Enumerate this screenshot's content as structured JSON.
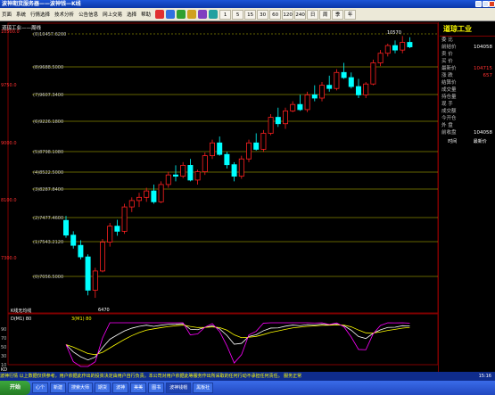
{
  "window": {
    "title": "波神期货服务器——波神钱—K线"
  },
  "menu": {
    "items": [
      "页面",
      "系统",
      "行情选择",
      "技术分析",
      "公告信息",
      "网上交易",
      "选择",
      "帮助"
    ],
    "periods": [
      "1",
      "5",
      "15",
      "30",
      "60",
      "120",
      "240",
      "日",
      "周",
      "季",
      "年"
    ]
  },
  "chart": {
    "header": "道琼工业——周线",
    "stat_label": "K线无均线",
    "indicator_labels": [
      "D(M1) 80",
      "3(M1) 80"
    ],
    "y_ticks": [
      "10500.0",
      "9750.0",
      "9000.0",
      "8100.0",
      "7300.0"
    ],
    "levels": [
      "(0)10457.6200",
      "(8)9688.5000",
      "(7)9607.3400",
      "(6)9226.1800",
      "(5)8798.1080",
      "(4)8522.5000",
      "(3)8287.8400",
      "(2)7477.4600",
      "(1)7543.2120",
      "(0)7056.5000"
    ],
    "high_marker": "10570",
    "low_marker": "6470",
    "sub_y_ticks": [
      "90",
      "70",
      "50",
      "30",
      "10"
    ],
    "sub_label": "KD"
  },
  "sidebar": {
    "title": "道琼工业",
    "rows": [
      {
        "k": "委 比",
        "v": ""
      },
      {
        "k": "前结价",
        "v": "104058"
      },
      {
        "k": "卖 价",
        "v": ""
      },
      {
        "k": "买 价",
        "v": ""
      },
      {
        "k": "最新价",
        "v": "104715"
      },
      {
        "k": "涨 跌",
        "v": "657"
      },
      {
        "k": "结算价",
        "v": ""
      },
      {
        "k": "成交量",
        "v": ""
      },
      {
        "k": "持仓量",
        "v": ""
      },
      {
        "k": "现 手",
        "v": ""
      },
      {
        "k": "成交额",
        "v": ""
      },
      {
        "k": "今开仓",
        "v": ""
      },
      {
        "k": "外 盘",
        "v": ""
      },
      {
        "k": "前收盘",
        "v": "104058"
      }
    ],
    "tabs": [
      "时间",
      "最新价"
    ]
  },
  "status": {
    "text": "波神行情 以上数据仅供参考，用户依据此作出的投资决定由用户自行负责。本公司对用户依据此等服务作出所采取的任何行动不承担任何责任。 服务正常",
    "time": "15:16"
  },
  "taskbar": {
    "start": "开始",
    "tasks": [
      "心个",
      "新建",
      "搜索大师",
      "期货",
      "波神",
      "美美",
      "图书",
      "波神钱帽",
      "黑板社"
    ]
  },
  "colors": {
    "up": "#ff2020",
    "down": "#00ffff",
    "level": "#c8c800",
    "k_line": "#ffffff",
    "d_line": "#ffff00",
    "j_line": "#ff00ff"
  },
  "chart_data": {
    "type": "candlestick",
    "title": "道琼工业——周线",
    "y_range": [
      6300,
      10700
    ],
    "ohlc": [
      [
        7690,
        7760,
        7420,
        7460
      ],
      [
        7460,
        7520,
        7250,
        7300
      ],
      [
        7300,
        7380,
        7080,
        7120
      ],
      [
        7120,
        7160,
        6520,
        6600
      ],
      [
        6600,
        6950,
        6480,
        6900
      ],
      [
        6900,
        7400,
        6880,
        7350
      ],
      [
        7350,
        7650,
        7280,
        7600
      ],
      [
        7600,
        7700,
        7450,
        7520
      ],
      [
        7520,
        7950,
        7480,
        7900
      ],
      [
        7900,
        8050,
        7820,
        8000
      ],
      [
        8000,
        8120,
        7900,
        8050
      ],
      [
        8050,
        8200,
        7980,
        8150
      ],
      [
        8150,
        8250,
        7950,
        7980
      ],
      [
        7980,
        8300,
        7960,
        8250
      ],
      [
        8250,
        8450,
        8200,
        8400
      ],
      [
        8400,
        8550,
        8300,
        8380
      ],
      [
        8380,
        8600,
        8350,
        8550
      ],
      [
        8550,
        8650,
        8300,
        8320
      ],
      [
        8320,
        8480,
        8250,
        8450
      ],
      [
        8450,
        8750,
        8400,
        8700
      ],
      [
        8700,
        8950,
        8650,
        8900
      ],
      [
        8900,
        9000,
        8700,
        8720
      ],
      [
        8720,
        8760,
        8500,
        8560
      ],
      [
        8560,
        8600,
        8300,
        8380
      ],
      [
        8380,
        8700,
        8340,
        8650
      ],
      [
        8650,
        8950,
        8600,
        8900
      ],
      [
        8900,
        9050,
        8780,
        8800
      ],
      [
        8800,
        9100,
        8760,
        9050
      ],
      [
        9050,
        9350,
        9020,
        9300
      ],
      [
        9300,
        9450,
        9150,
        9200
      ],
      [
        9200,
        9450,
        9120,
        9400
      ],
      [
        9400,
        9550,
        9380,
        9500
      ],
      [
        9500,
        9650,
        9400,
        9420
      ],
      [
        9420,
        9700,
        9380,
        9650
      ],
      [
        9650,
        9800,
        9550,
        9600
      ],
      [
        9600,
        9850,
        9550,
        9800
      ],
      [
        9800,
        9950,
        9700,
        9750
      ],
      [
        9750,
        10050,
        9720,
        10000
      ],
      [
        10000,
        10150,
        9900,
        9920
      ],
      [
        9920,
        10000,
        9750,
        9780
      ],
      [
        9780,
        9900,
        9600,
        9650
      ],
      [
        9650,
        9850,
        9600,
        9820
      ],
      [
        9820,
        10200,
        9800,
        10150
      ],
      [
        10150,
        10350,
        10100,
        10300
      ],
      [
        10300,
        10450,
        10250,
        10420
      ],
      [
        10420,
        10500,
        10300,
        10350
      ],
      [
        10350,
        10570,
        10300,
        10470
      ],
      [
        10470,
        10550,
        10380,
        10400
      ]
    ]
  }
}
